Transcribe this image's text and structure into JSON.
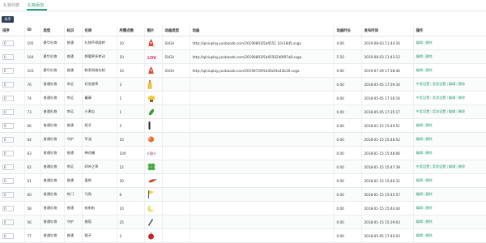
{
  "tabs": [
    {
      "label": "礼物列表",
      "active": false
    },
    {
      "label": "礼物添加",
      "active": true
    }
  ],
  "sort_button": "排序",
  "columns": [
    "排序",
    "ID",
    "类型",
    "标识",
    "名称",
    "所需点数",
    "图片",
    "动画类型",
    "动画",
    "动画时长",
    "发布时间",
    "操作"
  ],
  "rows": [
    {
      "sort": "0",
      "id": "105",
      "type": "豪华礼物",
      "mark": "普通",
      "name": "礼物不停旋转",
      "points": "10",
      "icon": "rocket",
      "anim_type": "SVGA",
      "anim": "http://qiniuplay.yunbaozb.com/20190803/5d4551 10c18d5.svga",
      "duration": "4.00",
      "time": "2019-08-03 11:44:16",
      "ops": [
        "编辑",
        "删除"
      ]
    },
    {
      "sort": "0",
      "id": "104",
      "type": "豪华礼物",
      "mark": "普通",
      "name": "想要更多转动",
      "points": "10",
      "icon": "love",
      "anim_type": "SVGA",
      "anim": "http://qiniuplay.yunbaozb.com/20190803/5d45502d0f97a8.svga",
      "duration": "5.50",
      "time": "2019-08-03 11:43:12",
      "ops": [
        "编辑",
        "删除"
      ]
    },
    {
      "sort": "0",
      "id": "103",
      "type": "豪华礼物",
      "mark": "普通",
      "name": "联系网络在制",
      "points": "10",
      "icon": "rocket",
      "anim_type": "SVGA",
      "anim": "http://qiniuplay.yunbaozb.com/20190729/5d3fa93a42b39.svga",
      "duration": "0.00",
      "time": "2019-07-29 17:38:40",
      "ops": [
        "编辑",
        "删除"
      ]
    },
    {
      "sort": "0",
      "id": "76",
      "type": "普通礼物",
      "mark": "幸运",
      "name": "初恋香草",
      "points": "3",
      "icon": "bottle",
      "anim_type": "",
      "anim": "",
      "duration": "0.00",
      "time": "2018-05-05 17:39:34",
      "ops": [
        "中奖设置",
        "奖池设置",
        "编辑",
        "删除"
      ]
    },
    {
      "sort": "0",
      "id": "74",
      "type": "普通礼物",
      "mark": "幸运",
      "name": "蔓藤",
      "points": "1",
      "icon": "plant",
      "anim_type": "",
      "anim": "",
      "duration": "0.00",
      "time": "2018-05-05 17:36:16",
      "ops": [
        "中奖设置",
        "奖池设置",
        "编辑",
        "删除"
      ]
    },
    {
      "sort": "0",
      "id": "73",
      "type": "普通礼物",
      "mark": "幸运",
      "name": "小黄瓜",
      "points": "1",
      "icon": "cucumber",
      "anim_type": "",
      "anim": "",
      "duration": "0.00",
      "time": "2018-05-05 17:35:17",
      "ops": [
        "中奖设置",
        "奖池设置",
        "编辑",
        "删除"
      ]
    },
    {
      "sort": "0",
      "id": "66",
      "type": "普通礼物",
      "mark": "普通",
      "name": "扭子",
      "points": "5",
      "icon": "stick",
      "anim_type": "",
      "anim": "",
      "duration": "0.00",
      "time": "2018-01-15 15:49:51",
      "ops": [
        "编辑",
        "删除"
      ]
    },
    {
      "sort": "0",
      "id": "64",
      "type": "普通礼物",
      "mark": "守护",
      "name": "苹油",
      "points": "10",
      "icon": "ball",
      "anim_type": "",
      "anim": "",
      "duration": "0.00",
      "time": "2018-01-15 15:48:52",
      "ops": [
        "编辑",
        "删除"
      ]
    },
    {
      "sort": "0",
      "id": "63",
      "type": "普通礼物",
      "mark": "普通",
      "name": "棒花糖",
      "points": "100",
      "icon": "candy",
      "anim_type": "",
      "anim": "",
      "duration": "0.00",
      "time": "2018-01-15 15:48:06",
      "ops": [
        "编辑",
        "删除"
      ]
    },
    {
      "sort": "0",
      "id": "62",
      "type": "普通礼物",
      "mark": "幸运",
      "name": "四叶之草",
      "points": "12",
      "icon": "clover",
      "anim_type": "",
      "anim": "",
      "duration": "0.00",
      "time": "2018-01-15 15:47:39",
      "ops": [
        "中奖设置",
        "奖池设置",
        "编辑",
        "删除"
      ]
    },
    {
      "sort": "0",
      "id": "61",
      "type": "普通礼物",
      "mark": "普通",
      "name": "蛋郎",
      "points": "20",
      "icon": "chili",
      "anim_type": "",
      "anim": "",
      "duration": "0.00",
      "time": "2018-01-15 15:46:31",
      "ops": [
        "编辑",
        "删除"
      ]
    },
    {
      "sort": "0",
      "id": "60",
      "type": "普通礼物",
      "mark": "热门",
      "name": "马兔",
      "points": "6",
      "icon": "flag",
      "anim_type": "",
      "anim": "",
      "duration": "0.00",
      "time": "2018-01-15 15:45:57",
      "ops": [
        "编辑",
        "删除"
      ]
    },
    {
      "sort": "0",
      "id": "58",
      "type": "普通礼物",
      "mark": "普通",
      "name": "街街街",
      "points": "10",
      "icon": "moon",
      "anim_type": "",
      "anim": "",
      "duration": "0.00",
      "time": "2018-01-15 15:44:44",
      "ops": [
        "编辑",
        "删除"
      ]
    },
    {
      "sort": "0",
      "id": "56",
      "type": "普通礼物",
      "mark": "守护",
      "name": "香萄",
      "points": "25",
      "icon": "knife",
      "anim_type": "",
      "anim": "",
      "duration": "0.00",
      "time": "2018-01-15 15:39:03",
      "ops": [
        "编辑",
        "删除"
      ]
    },
    {
      "sort": "0",
      "id": "77",
      "type": "普通礼物",
      "mark": "普通",
      "name": "毯子",
      "points": "2",
      "icon": "cherry",
      "anim_type": "",
      "anim": "",
      "duration": "0.00",
      "time": "2018-05-05 17:40:03",
      "ops": [
        "编辑",
        "删除"
      ]
    }
  ],
  "colors": {
    "accent": "#27a07a",
    "button_dark": "#2f3f55"
  }
}
